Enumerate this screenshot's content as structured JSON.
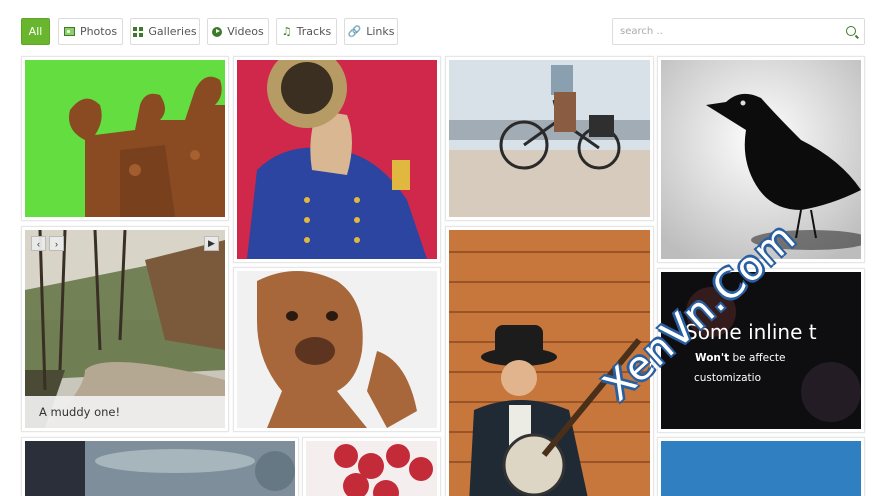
{
  "filters": {
    "all": "All",
    "photos": "Photos",
    "galleries": "Galleries",
    "videos": "Videos",
    "tracks": "Tracks",
    "links": "Links"
  },
  "search": {
    "placeholder": "search .."
  },
  "tiles": {
    "gallery_caption": "A muddy one!",
    "inline": {
      "title": "Some inline t",
      "line1_bold": "Won't",
      "line1_rest": " be affecte",
      "line2": "customizatio"
    }
  },
  "watermark": "XenVn.Com",
  "colors": {
    "accent": "#6ab52e"
  }
}
